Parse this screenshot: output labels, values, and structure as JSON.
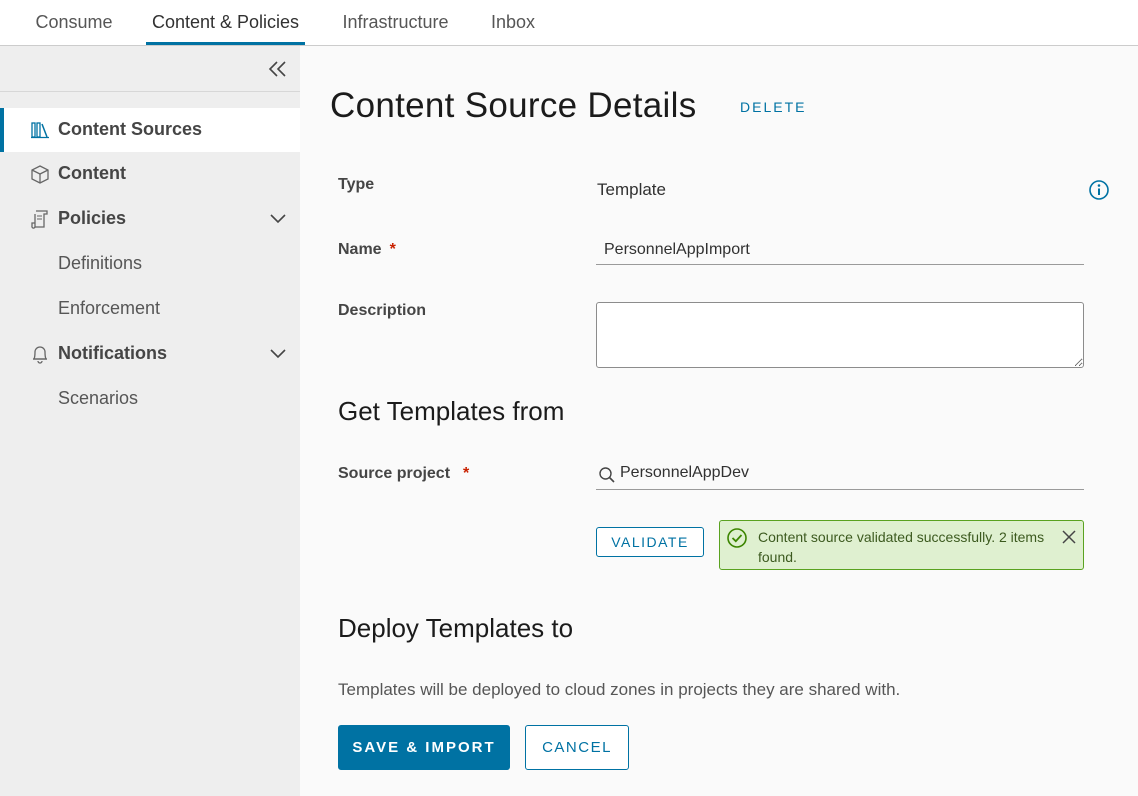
{
  "topnav": {
    "tabs": [
      {
        "label": "Consume"
      },
      {
        "label": "Content & Policies"
      },
      {
        "label": "Infrastructure"
      },
      {
        "label": "Inbox"
      }
    ]
  },
  "sidebar": {
    "items": [
      {
        "label": "Content Sources",
        "icon": "library-icon"
      },
      {
        "label": "Content",
        "icon": "box-icon"
      },
      {
        "label": "Policies",
        "icon": "scroll-icon"
      },
      {
        "label": "Definitions"
      },
      {
        "label": "Enforcement"
      },
      {
        "label": "Notifications",
        "icon": "bell-icon"
      },
      {
        "label": "Scenarios"
      }
    ]
  },
  "page": {
    "title": "Content Source Details",
    "delete_label": "DELETE"
  },
  "form": {
    "type_label": "Type",
    "type_value": "Template",
    "name_label": "Name",
    "required_mark": "*",
    "name_value": "PersonnelAppImport",
    "description_label": "Description",
    "description_value": ""
  },
  "get_templates": {
    "heading": "Get Templates from",
    "source_project_label": "Source project",
    "source_project_value": "PersonnelAppDev",
    "validate_label": "VALIDATE",
    "alert_text": "Content source validated successfully. 2 items found."
  },
  "deploy": {
    "heading": "Deploy Templates to",
    "note": "Templates will be deployed to cloud zones in projects they are shared with."
  },
  "actions": {
    "save_label": "SAVE & IMPORT",
    "cancel_label": "CANCEL"
  },
  "colors": {
    "accent": "#0072a3",
    "success_bg": "#dff0d0",
    "success_border": "#5aa220",
    "required": "#c92100"
  }
}
